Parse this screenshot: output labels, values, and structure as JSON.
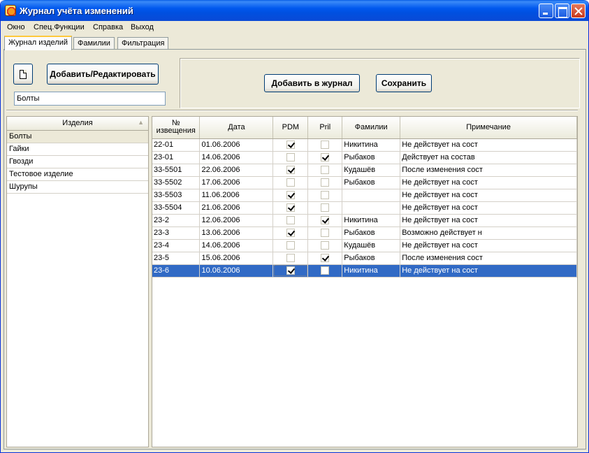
{
  "window": {
    "title": "Журнал учёта изменений"
  },
  "menu": [
    "Окно",
    "Спец.Функции",
    "Справка",
    "Выход"
  ],
  "tabs": [
    "Журнал изделий",
    "Фамилии",
    "Фильтрация"
  ],
  "toolbar": {
    "new_icon": "new-document-icon",
    "edit_label": "Добавить/Редактировать",
    "name_value": "Болты",
    "add_journal_label": "Добавить в журнал",
    "save_label": "Сохранить"
  },
  "products": {
    "header": "Изделия",
    "sort_glyph": "▲",
    "items": [
      "Болты",
      "Гайки",
      "Гвозди",
      "Тестовое изделие",
      "Шурупы"
    ],
    "selected_index": 0
  },
  "journal": {
    "columns": [
      "№ извещения",
      "Дата",
      "PDM",
      "Pril",
      "Фамилии",
      "Примечание"
    ],
    "rows": [
      {
        "num": "22-01",
        "date": "01.06.2006",
        "pdm": true,
        "pril": false,
        "name": "Никитина",
        "note": "Не действует на сост"
      },
      {
        "num": "23-01",
        "date": "14.06.2006",
        "pdm": false,
        "pril": true,
        "name": "Рыбаков",
        "note": "Действует на состав"
      },
      {
        "num": "33-5501",
        "date": "22.06.2006",
        "pdm": true,
        "pril": false,
        "name": "Кудашёв",
        "note": "После изменения сост"
      },
      {
        "num": "33-5502",
        "date": "17.06.2006",
        "pdm": false,
        "pril": false,
        "name": "Рыбаков",
        "note": "Не действует на сост"
      },
      {
        "num": "33-5503",
        "date": "11.06.2006",
        "pdm": true,
        "pril": false,
        "name": "",
        "note": "Не действует на сост"
      },
      {
        "num": "33-5504",
        "date": "21.06.2006",
        "pdm": true,
        "pril": false,
        "name": "",
        "note": "Не действует на сост"
      },
      {
        "num": "23-2",
        "date": "12.06.2006",
        "pdm": false,
        "pril": true,
        "name": "Никитина",
        "note": "Не действует на сост"
      },
      {
        "num": "23-3",
        "date": "13.06.2006",
        "pdm": true,
        "pril": false,
        "name": "Рыбаков",
        "note": "Возможно действует н"
      },
      {
        "num": "23-4",
        "date": "14.06.2006",
        "pdm": false,
        "pril": false,
        "name": "Кудашёв",
        "note": "Не действует на сост"
      },
      {
        "num": "23-5",
        "date": "15.06.2006",
        "pdm": false,
        "pril": true,
        "name": "Рыбаков",
        "note": "После изменения сост"
      },
      {
        "num": "23-6",
        "date": "10.06.2006",
        "pdm": true,
        "pril": false,
        "name": "Никитина",
        "note": "Не действует на сост"
      }
    ],
    "selected_index": 10
  },
  "colors": {
    "titlebar": "#0058ee",
    "selection": "#316ac5",
    "face": "#ece9d8"
  }
}
